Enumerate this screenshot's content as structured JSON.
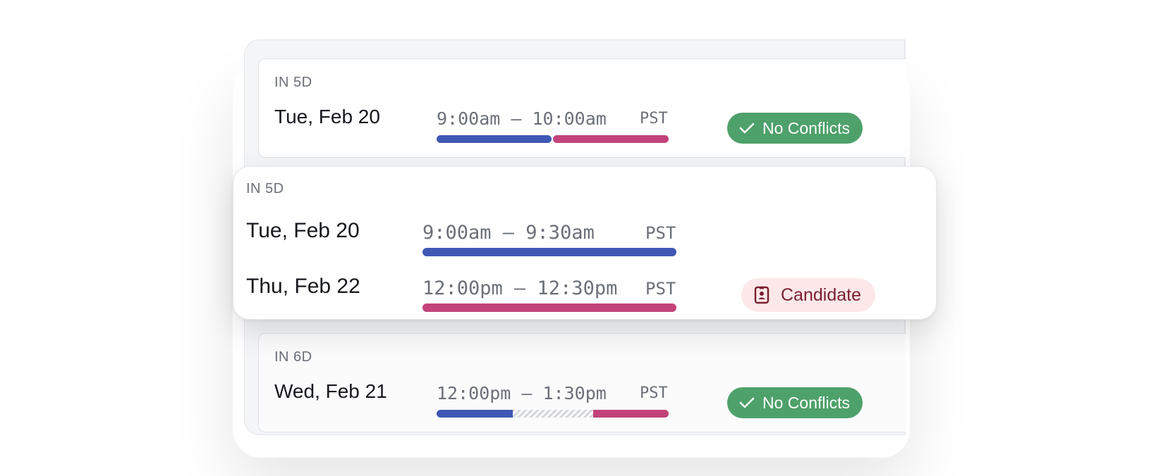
{
  "cards": {
    "top": {
      "relative_day": "IN 5D",
      "date": "Tue, Feb 20",
      "time_range": "9:00am – 10:00am",
      "timezone": "PST",
      "status": "No Conflicts",
      "status_icon": "check-icon"
    },
    "expanded": {
      "relative_day": "IN 5D",
      "slots": [
        {
          "date": "Tue, Feb 20",
          "time_range": "9:00am – 9:30am",
          "timezone": "PST"
        },
        {
          "date": "Thu, Feb 22",
          "time_range": "12:00pm – 12:30pm",
          "timezone": "PST"
        }
      ],
      "tag": "Candidate",
      "tag_icon": "id-badge-icon"
    },
    "bottom": {
      "relative_day": "IN 6D",
      "date": "Wed, Feb 21",
      "time_range": "12:00pm – 1:30pm",
      "timezone": "PST",
      "status": "No Conflicts",
      "status_icon": "check-icon"
    }
  },
  "colors": {
    "interviewer_bar": "#3f58b4",
    "candidate_bar": "#c2437a",
    "no_conflicts_pill": "#4ea16a",
    "candidate_pill_bg": "#fde8e9",
    "candidate_pill_text": "#7a1f2e"
  }
}
